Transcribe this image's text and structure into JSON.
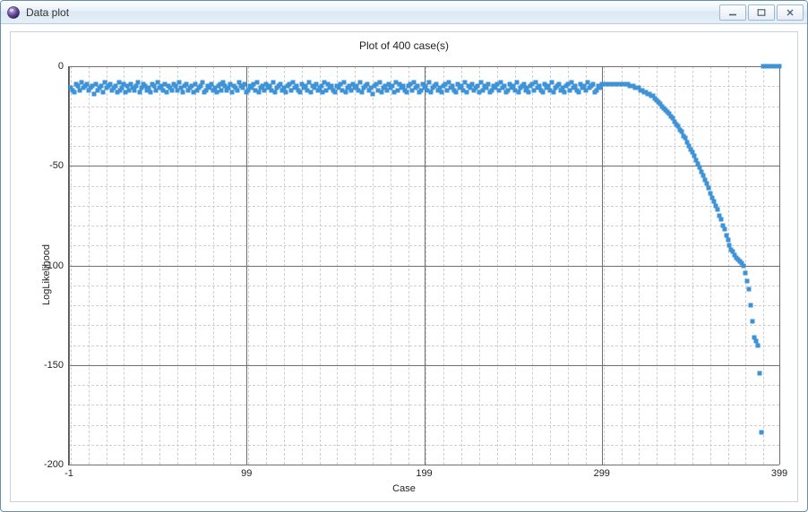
{
  "window": {
    "title": "Data plot",
    "app_icon": "sphere-icon"
  },
  "chart_data": {
    "type": "scatter",
    "title": "Plot of 400 case(s)",
    "xlabel": "Case",
    "ylabel": "LogLikelihood",
    "xlim": [
      -1,
      399
    ],
    "ylim": [
      -200,
      0
    ],
    "x_ticks": [
      -1,
      99,
      199,
      299,
      399
    ],
    "y_ticks": [
      0,
      -50,
      -100,
      -150,
      -200
    ],
    "x_minor_step": 10,
    "y_minor_step": 10,
    "marker_color": "#3e93d6",
    "series": [
      {
        "name": "LogLikelihood",
        "x": [
          0,
          1,
          2,
          3,
          4,
          5,
          6,
          7,
          8,
          9,
          10,
          11,
          12,
          13,
          14,
          15,
          16,
          17,
          18,
          19,
          20,
          21,
          22,
          23,
          24,
          25,
          26,
          27,
          28,
          29,
          30,
          31,
          32,
          33,
          34,
          35,
          36,
          37,
          38,
          39,
          40,
          41,
          42,
          43,
          44,
          45,
          46,
          47,
          48,
          49,
          50,
          51,
          52,
          53,
          54,
          55,
          56,
          57,
          58,
          59,
          60,
          61,
          62,
          63,
          64,
          65,
          66,
          67,
          68,
          69,
          70,
          71,
          72,
          73,
          74,
          75,
          76,
          77,
          78,
          79,
          80,
          81,
          82,
          83,
          84,
          85,
          86,
          87,
          88,
          89,
          90,
          91,
          92,
          93,
          94,
          95,
          96,
          97,
          98,
          99,
          100,
          101,
          102,
          103,
          104,
          105,
          106,
          107,
          108,
          109,
          110,
          111,
          112,
          113,
          114,
          115,
          116,
          117,
          118,
          119,
          120,
          121,
          122,
          123,
          124,
          125,
          126,
          127,
          128,
          129,
          130,
          131,
          132,
          133,
          134,
          135,
          136,
          137,
          138,
          139,
          140,
          141,
          142,
          143,
          144,
          145,
          146,
          147,
          148,
          149,
          150,
          151,
          152,
          153,
          154,
          155,
          156,
          157,
          158,
          159,
          160,
          161,
          162,
          163,
          164,
          165,
          166,
          167,
          168,
          169,
          170,
          171,
          172,
          173,
          174,
          175,
          176,
          177,
          178,
          179,
          180,
          181,
          182,
          183,
          184,
          185,
          186,
          187,
          188,
          189,
          190,
          191,
          192,
          193,
          194,
          195,
          196,
          197,
          198,
          199,
          200,
          201,
          202,
          203,
          204,
          205,
          206,
          207,
          208,
          209,
          210,
          211,
          212,
          213,
          214,
          215,
          216,
          217,
          218,
          219,
          220,
          221,
          222,
          223,
          224,
          225,
          226,
          227,
          228,
          229,
          230,
          231,
          232,
          233,
          234,
          235,
          236,
          237,
          238,
          239,
          240,
          241,
          242,
          243,
          244,
          245,
          246,
          247,
          248,
          249,
          250,
          251,
          252,
          253,
          254,
          255,
          256,
          257,
          258,
          259,
          260,
          261,
          262,
          263,
          264,
          265,
          266,
          267,
          268,
          269,
          270,
          271,
          272,
          273,
          274,
          275,
          276,
          277,
          278,
          279,
          280,
          281,
          282,
          283,
          284,
          285,
          286,
          287,
          288,
          289,
          290,
          291,
          292,
          293,
          294,
          295,
          296,
          297,
          298,
          299,
          300,
          301,
          302,
          303,
          304,
          305,
          306,
          307,
          308,
          309,
          310,
          311,
          312,
          313,
          314,
          315,
          316,
          317,
          318,
          319,
          320,
          321,
          322,
          323,
          324,
          325,
          326,
          327,
          328,
          329,
          330,
          331,
          332,
          333,
          334,
          335,
          336,
          337,
          338,
          339,
          340,
          341,
          342,
          343,
          344,
          345,
          346,
          347,
          348,
          349,
          350,
          351,
          352,
          353,
          354,
          355,
          356,
          357,
          358,
          359,
          360,
          361,
          362,
          363,
          364,
          365,
          366,
          367,
          368,
          369,
          370,
          371,
          372,
          373,
          374,
          375,
          376,
          377,
          378,
          379,
          380,
          381,
          382,
          383,
          384,
          385,
          386,
          387,
          388,
          389,
          390,
          391,
          392,
          393,
          394,
          395,
          396,
          397,
          398,
          399
        ],
        "y": [
          -11,
          -12,
          -13,
          -9,
          -10,
          -12,
          -8,
          -11,
          -10,
          -9,
          -12,
          -11,
          -10,
          -14,
          -9,
          -12,
          -11,
          -10,
          -13,
          -8,
          -11,
          -10,
          -9,
          -12,
          -11,
          -10,
          -13,
          -8,
          -12,
          -11,
          -9,
          -13,
          -10,
          -12,
          -9,
          -11,
          -12,
          -10,
          -8,
          -13,
          -11,
          -9,
          -10,
          -12,
          -11,
          -13,
          -9,
          -10,
          -12,
          -8,
          -11,
          -10,
          -12,
          -9,
          -13,
          -10,
          -11,
          -12,
          -9,
          -10,
          -12,
          -8,
          -11,
          -13,
          -10,
          -9,
          -12,
          -11,
          -10,
          -13,
          -9,
          -12,
          -11,
          -10,
          -8,
          -13,
          -12,
          -10,
          -11,
          -9,
          -12,
          -11,
          -13,
          -10,
          -9,
          -12,
          -8,
          -10,
          -12,
          -11,
          -9,
          -13,
          -10,
          -11,
          -12,
          -8,
          -10,
          -11,
          -9,
          -13,
          -12,
          -10,
          -11,
          -9,
          -12,
          -8,
          -13,
          -11,
          -10,
          -12,
          -9,
          -11,
          -10,
          -12,
          -8,
          -13,
          -11,
          -10,
          -9,
          -12,
          -11,
          -13,
          -10,
          -9,
          -12,
          -8,
          -11,
          -10,
          -12,
          -13,
          -9,
          -11,
          -10,
          -12,
          -8,
          -13,
          -10,
          -11,
          -9,
          -12,
          -11,
          -10,
          -13,
          -8,
          -12,
          -9,
          -11,
          -10,
          -12,
          -13,
          -10,
          -11,
          -9,
          -12,
          -8,
          -13,
          -11,
          -10,
          -12,
          -9,
          -11,
          -10,
          -12,
          -8,
          -13,
          -11,
          -10,
          -9,
          -12,
          -11,
          -14,
          -10,
          -9,
          -12,
          -8,
          -13,
          -11,
          -10,
          -12,
          -9,
          -11,
          -10,
          -13,
          -8,
          -12,
          -9,
          -11,
          -10,
          -12,
          -13,
          -10,
          -9,
          -12,
          -8,
          -11,
          -10,
          -13,
          -12,
          -9,
          -11,
          -10,
          -12,
          -8,
          -13,
          -11,
          -10,
          -9,
          -12,
          -11,
          -13,
          -10,
          -9,
          -12,
          -8,
          -11,
          -10,
          -12,
          -13,
          -9,
          -11,
          -10,
          -12,
          -8,
          -13,
          -10,
          -11,
          -9,
          -12,
          -11,
          -10,
          -13,
          -8,
          -12,
          -10,
          -11,
          -9,
          -13,
          -12,
          -10,
          -11,
          -9,
          -12,
          -8,
          -11,
          -10,
          -13,
          -12,
          -9,
          -11,
          -10,
          -12,
          -8,
          -13,
          -11,
          -10,
          -9,
          -12,
          -11,
          -13,
          -10,
          -9,
          -12,
          -8,
          -11,
          -10,
          -12,
          -13,
          -9,
          -11,
          -10,
          -12,
          -8,
          -13,
          -11,
          -10,
          -9,
          -12,
          -11,
          -13,
          -10,
          -9,
          -12,
          -8,
          -11,
          -10,
          -12,
          -13,
          -9,
          -11,
          -10,
          -12,
          -8,
          -11,
          -10,
          -9,
          -13,
          -12,
          -10,
          -11,
          -9,
          -9,
          -9,
          -9,
          -9,
          -9,
          -9,
          -9,
          -9,
          -9,
          -9,
          -9,
          -9,
          -9,
          -9,
          -9,
          -10,
          -10,
          -10,
          -11,
          -11,
          -11,
          -12,
          -12,
          -13,
          -13,
          -14,
          -14,
          -15,
          -15,
          -16,
          -17,
          -18,
          -19,
          -20,
          -21,
          -22,
          -23,
          -24,
          -25,
          -26,
          -28,
          -29,
          -30,
          -32,
          -33,
          -35,
          -36,
          -38,
          -40,
          -42,
          -43,
          -45,
          -47,
          -49,
          -51,
          -53,
          -55,
          -57,
          -59,
          -61,
          -64,
          -66,
          -68,
          -70,
          -72,
          -75,
          -77,
          -80,
          -82,
          -85,
          -87,
          -90,
          -92,
          -93,
          -95,
          -96,
          -97,
          -98,
          -99,
          -100,
          -104,
          -108,
          -112,
          -120,
          -128,
          -136,
          -138,
          -140,
          -154,
          -184
        ]
      }
    ]
  }
}
